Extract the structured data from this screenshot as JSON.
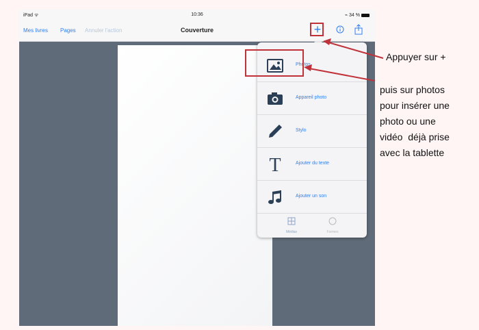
{
  "status_bar": {
    "carrier": "iPad ᯤ",
    "time": "10:36",
    "battery": "⌁ 34 %"
  },
  "nav": {
    "my_books": "Mes livres",
    "pages": "Pages",
    "undo": "Annuler l'action",
    "title": "Couverture"
  },
  "toolbar": {
    "add_label": "+",
    "info_label": "ⓘ"
  },
  "menu": {
    "items": [
      {
        "label": "Photos"
      },
      {
        "label": "Appareil photo"
      },
      {
        "label": "Stylo"
      },
      {
        "label": "Ajouter du texte"
      },
      {
        "label": "Ajouter un son"
      }
    ],
    "tabs": [
      {
        "label": "Médias"
      },
      {
        "label": "Formes"
      }
    ]
  },
  "annotations": {
    "first": "Appuyer sur +",
    "second_lines": [
      "puis sur photos",
      "pour insérer une",
      "photo ou une",
      "vidéo  déjà prise",
      "avec la tablette"
    ]
  },
  "colors": {
    "accent": "#2f7ef0",
    "annotation_red": "#c0313a",
    "background": "#5f6b78"
  }
}
